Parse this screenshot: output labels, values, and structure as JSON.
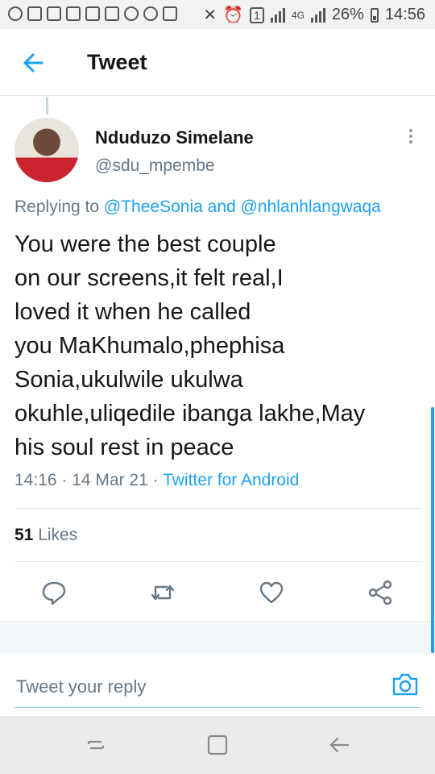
{
  "status_bar": {
    "battery_percent": "26%",
    "network": "4G",
    "sim_slot": "1",
    "time": "14:56"
  },
  "header": {
    "title": "Tweet",
    "back_icon": "arrow-left-icon"
  },
  "tweet": {
    "author_name": "Nduduzo Simelane",
    "author_handle": "@sdu_mpembe",
    "replying_prefix": "Replying to",
    "replying_user_1": "@TheeSonia",
    "replying_and": "and",
    "replying_user_2": "@nhlanhlangwaqa",
    "text_lines": [
      "You were the best couple",
      "on our screens,it felt real,I",
      "loved it when he called",
      "you MaKhumalo,phephisa",
      "Sonia,ukulwile ukulwa",
      "okuhle,uliqedile ibanga lakhe,May",
      "his soul rest in peace"
    ],
    "time": "14:16",
    "date": "14 Mar 21",
    "source": "Twitter for Android",
    "likes_count": "51",
    "likes_label": "Likes"
  },
  "actions": [
    "reply-icon",
    "retweet-icon",
    "heart-icon",
    "share-icon"
  ],
  "reply": {
    "placeholder": "Tweet your reply",
    "camera_icon": "camera-icon"
  },
  "colors": {
    "accent": "#1da1f2",
    "text_primary": "#14171a",
    "text_secondary": "#657786"
  }
}
